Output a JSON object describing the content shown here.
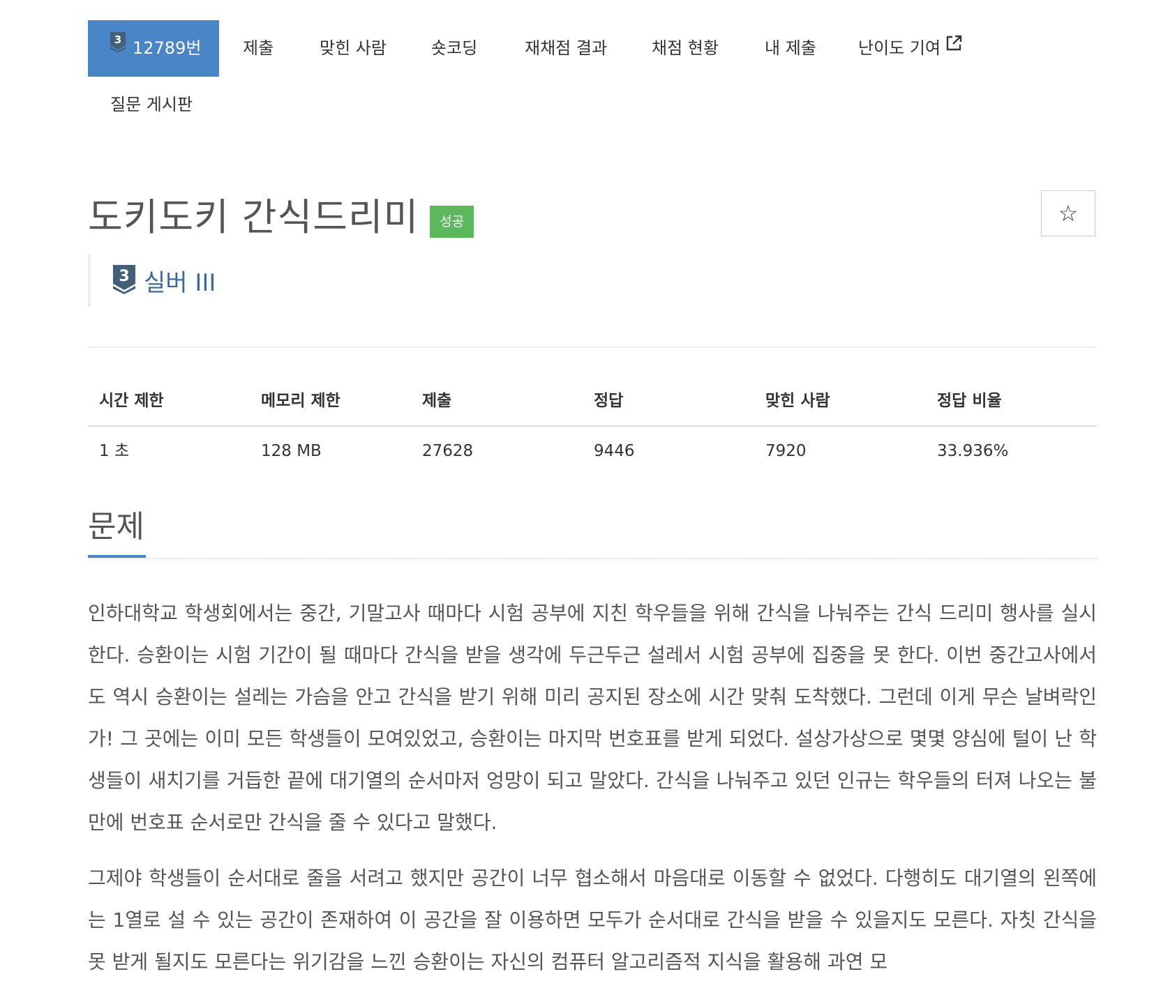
{
  "nav": {
    "active_tab": {
      "tier_number": "3",
      "label": "12789번"
    },
    "items": [
      {
        "label": "제출"
      },
      {
        "label": "맞힌 사람"
      },
      {
        "label": "숏코딩"
      },
      {
        "label": "재채점 결과"
      },
      {
        "label": "채점 현황"
      },
      {
        "label": "내 제출"
      },
      {
        "label": "난이도 기여"
      },
      {
        "label": "질문 게시판"
      }
    ]
  },
  "problem": {
    "title": "도키도키 간식드리미",
    "status_label": "성공",
    "star_button": "☆",
    "tier_number": "3",
    "tier_label": "실버 III"
  },
  "info_table": {
    "headers": [
      "시간 제한",
      "메모리 제한",
      "제출",
      "정답",
      "맞힌 사람",
      "정답 비율"
    ],
    "values": [
      "1 초",
      "128 MB",
      "27628",
      "9446",
      "7920",
      "33.936%"
    ]
  },
  "section": {
    "title": "문제"
  },
  "description": {
    "paragraphs": [
      "인하대학교 학생회에서는 중간, 기말고사 때마다 시험 공부에 지친 학우들을 위해 간식을 나눠주는 간식 드리미 행사를 실시한다. 승환이는 시험 기간이 될 때마다 간식을 받을 생각에 두근두근 설레서 시험 공부에 집중을 못 한다. 이번 중간고사에서도 역시 승환이는 설레는 가슴을 안고 간식을 받기 위해 미리 공지된 장소에 시간 맞춰 도착했다. 그런데 이게 무슨 날벼락인가! 그 곳에는 이미 모든 학생들이 모여있었고, 승환이는 마지막 번호표를 받게 되었다. 설상가상으로 몇몇 양심에 털이 난 학생들이 새치기를 거듭한 끝에 대기열의 순서마저 엉망이 되고 말았다. 간식을 나눠주고 있던 인규는 학우들의 터져 나오는 불만에 번호표 순서로만 간식을 줄 수 있다고 말했다.",
      "그제야 학생들이 순서대로 줄을 서려고 했지만 공간이 너무 협소해서 마음대로 이동할 수 없었다. 다행히도 대기열의 왼쪽에는 1열로 설 수 있는 공간이 존재하여 이 공간을 잘 이용하면 모두가 순서대로 간식을 받을 수 있을지도 모른다. 자칫 간식을 못 받게 될지도 모른다는 위기감을 느낀 승환이는 자신의 컴퓨터 알고리즘적 지식을 활용해 과연 모"
    ]
  },
  "colors": {
    "accent": "#4a85c8",
    "success": "#5cb85c",
    "tier_text": "#3d6a9d",
    "tier_badge": "#435f7a"
  },
  "icons": {
    "tier_badge": "silver-tier-badge-icon",
    "external_link": "external-link-icon",
    "star": "star-outline-icon"
  }
}
